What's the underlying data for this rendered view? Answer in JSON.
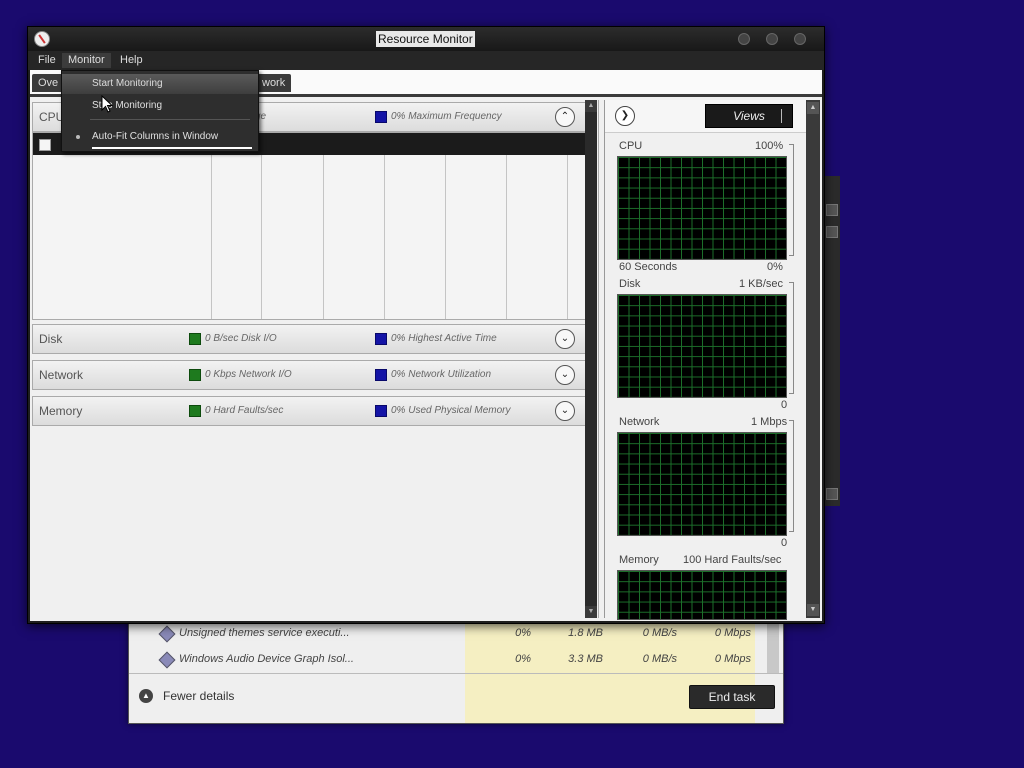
{
  "window": {
    "title": "Resource Monitor"
  },
  "menu": {
    "file": "File",
    "monitor": "Monitor",
    "help": "Help"
  },
  "monitor_menu": {
    "start": "Start Monitoring",
    "stop": "Stop Monitoring",
    "autofit": "Auto-Fit Columns in Window"
  },
  "tabs": {
    "overview": "Ove",
    "network": "work"
  },
  "sections": {
    "cpu": {
      "label": "CPU",
      "stat1": "ge",
      "stat2": "0% Maximum Frequency"
    },
    "disk": {
      "label": "Disk",
      "stat1": "0 B/sec Disk I/O",
      "stat2": "0% Highest Active Time"
    },
    "network": {
      "label": "Network",
      "stat1": "0 Kbps Network I/O",
      "stat2": "0% Network Utilization"
    },
    "memory": {
      "label": "Memory",
      "stat1": "0 Hard Faults/sec",
      "stat2": "0% Used Physical Memory"
    }
  },
  "views": {
    "label": "Views"
  },
  "graphs": {
    "cpu": {
      "title": "CPU",
      "max": "100%",
      "time": "60 Seconds",
      "min": "0%"
    },
    "disk": {
      "title": "Disk",
      "max": "1 KB/sec",
      "min": "0"
    },
    "network": {
      "title": "Network",
      "max": "1 Mbps",
      "min": "0"
    },
    "memory": {
      "title": "Memory",
      "max": "100 Hard Faults/sec"
    }
  },
  "taskmanager": {
    "rows": [
      {
        "name": "Unsigned themes service executi...",
        "cpu": "0%",
        "mem": "1.8 MB",
        "disk": "0 MB/s",
        "net": "0 Mbps"
      },
      {
        "name": "Windows Audio Device Graph Isol...",
        "cpu": "0%",
        "mem": "3.3 MB",
        "disk": "0 MB/s",
        "net": "0 Mbps"
      }
    ],
    "fewer_details": "Fewer details",
    "end_task": "End task"
  }
}
